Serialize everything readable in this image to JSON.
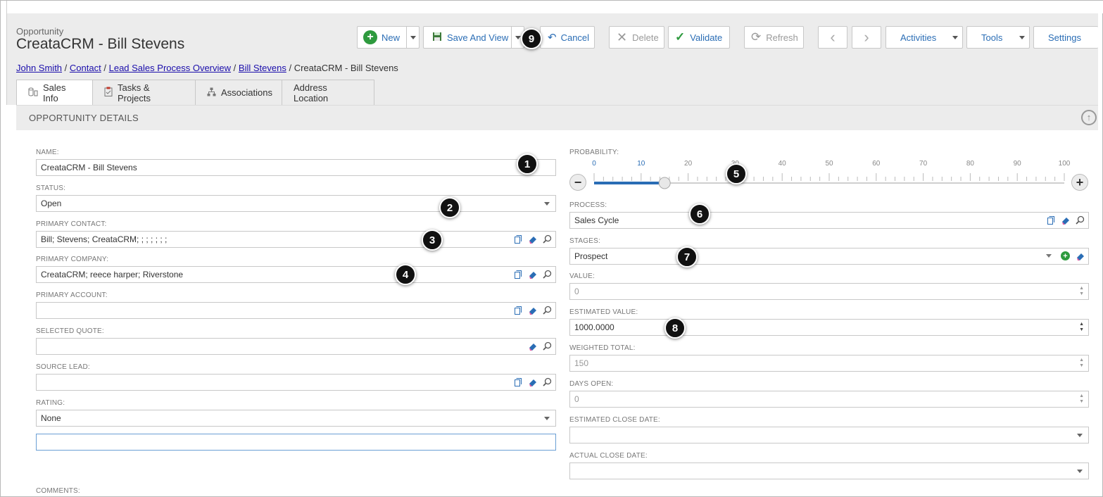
{
  "header": {
    "entity_type": "Opportunity",
    "title": "CreataCRM - Bill Stevens"
  },
  "toolbar": {
    "new_label": "New",
    "save_view_label": "Save And View",
    "cancel_label": "Cancel",
    "delete_label": "Delete",
    "validate_label": "Validate",
    "refresh_label": "Refresh",
    "activities_label": "Activities",
    "tools_label": "Tools",
    "settings_label": "Settings"
  },
  "breadcrumb": {
    "items": [
      "John Smith",
      "Contact",
      "Lead Sales Process Overview",
      "Bill Stevens"
    ],
    "current": "CreataCRM - Bill Stevens",
    "separator": "/"
  },
  "tabs": [
    {
      "label": "Sales Info",
      "icon": "database-icon",
      "active": true
    },
    {
      "label": "Tasks & Projects",
      "icon": "clipboard-icon",
      "active": false
    },
    {
      "label": "Associations",
      "icon": "hierarchy-icon",
      "active": false
    },
    {
      "label": "Address Location",
      "icon": "",
      "active": false
    }
  ],
  "section": {
    "title": "OPPORTUNITY DETAILS"
  },
  "left_fields": {
    "name": {
      "label": "NAME:",
      "value": "CreataCRM - Bill Stevens"
    },
    "status": {
      "label": "STATUS:",
      "value": "Open"
    },
    "primary_contact": {
      "label": "PRIMARY CONTACT:",
      "value": "Bill; Stevens; CreataCRM; ; ; ; ; ; ;"
    },
    "primary_company": {
      "label": "PRIMARY COMPANY:",
      "value": "CreataCRM; reece harper; Riverstone"
    },
    "primary_account": {
      "label": "PRIMARY ACCOUNT:",
      "value": ""
    },
    "selected_quote": {
      "label": "SELECTED QUOTE:",
      "value": ""
    },
    "source_lead": {
      "label": "SOURCE LEAD:",
      "value": ""
    },
    "rating": {
      "label": "RATING:",
      "value": "None"
    },
    "rating_extra": {
      "value": ""
    },
    "comments": {
      "label": "COMMENTS:"
    }
  },
  "right_fields": {
    "probability": {
      "label": "PROBABILITY:",
      "ticks": [
        "0",
        "10",
        "20",
        "30",
        "40",
        "50",
        "60",
        "70",
        "80",
        "90",
        "100"
      ],
      "value": 15
    },
    "process": {
      "label": "PROCESS:",
      "value": "Sales Cycle"
    },
    "stages": {
      "label": "STAGES:",
      "value": "Prospect"
    },
    "value": {
      "label": "VALUE:",
      "value": "0"
    },
    "estimated_value": {
      "label": "ESTIMATED VALUE:",
      "value": "1000.0000"
    },
    "weighted_total": {
      "label": "WEIGHTED TOTAL:",
      "value": "150"
    },
    "days_open": {
      "label": "DAYS OPEN:",
      "value": "0"
    },
    "estimated_close_date": {
      "label": "ESTIMATED CLOSE DATE:",
      "value": ""
    },
    "actual_close_date": {
      "label": "ACTUAL CLOSE DATE:",
      "value": ""
    }
  },
  "callouts": [
    "1",
    "2",
    "3",
    "4",
    "5",
    "6",
    "7",
    "8",
    "9"
  ],
  "colors": {
    "accent": "#2a6db5",
    "success": "#2e9a3e",
    "header_bg": "#ececec",
    "callout": "#111111"
  }
}
